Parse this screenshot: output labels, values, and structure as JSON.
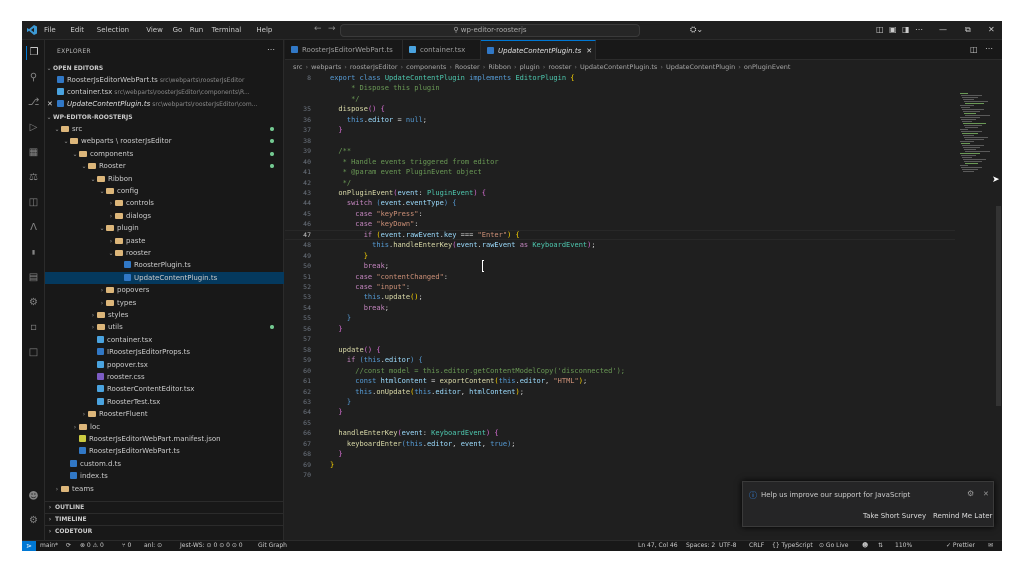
{
  "titlebar": {
    "menus": [
      "File",
      "Edit",
      "Selection",
      "View",
      "Go",
      "Run",
      "Terminal",
      "Help"
    ],
    "search": "wp-editor-roosterjs",
    "account": "⛭⌄"
  },
  "sidebar": {
    "title": "EXPLORER",
    "open_editors_label": "OPEN EDITORS",
    "open_editors": [
      {
        "name": "RoosterJsEditorWebPart.ts",
        "path": "src\\webparts\\roosterJsEditor",
        "icon": "ts"
      },
      {
        "name": "container.tsx",
        "path": "src\\webparts\\roosterJsEditor\\components\\R...",
        "icon": "tsx"
      },
      {
        "name": "UpdateContentPlugin.ts",
        "path": "src\\webparts\\roosterJsEditor\\com...",
        "icon": "ts",
        "active": true,
        "close": "✕"
      }
    ],
    "project_label": "WP-EDITOR-ROOSTERJS",
    "tree": [
      {
        "label": "src",
        "depth": 0,
        "kind": "folder-open",
        "dot": true
      },
      {
        "label": "webparts \\ roosterJsEditor",
        "depth": 1,
        "kind": "folder-open",
        "dot": true
      },
      {
        "label": "components",
        "depth": 2,
        "kind": "folder-open",
        "dot": true
      },
      {
        "label": "Rooster",
        "depth": 3,
        "kind": "folder-open",
        "dot": true
      },
      {
        "label": "Ribbon",
        "depth": 4,
        "kind": "folder-open"
      },
      {
        "label": "config",
        "depth": 5,
        "kind": "folder-open"
      },
      {
        "label": "controls",
        "depth": 6,
        "kind": "folder"
      },
      {
        "label": "dialogs",
        "depth": 6,
        "kind": "folder"
      },
      {
        "label": "plugin",
        "depth": 5,
        "kind": "folder-open"
      },
      {
        "label": "paste",
        "depth": 6,
        "kind": "folder"
      },
      {
        "label": "rooster",
        "depth": 6,
        "kind": "folder-open"
      },
      {
        "label": "RoosterPlugin.ts",
        "depth": 7,
        "kind": "ts"
      },
      {
        "label": "UpdateContentPlugin.ts",
        "depth": 7,
        "kind": "ts",
        "selected": true
      },
      {
        "label": "popovers",
        "depth": 5,
        "kind": "folder"
      },
      {
        "label": "types",
        "depth": 5,
        "kind": "folder"
      },
      {
        "label": "styles",
        "depth": 4,
        "kind": "folder"
      },
      {
        "label": "utils",
        "depth": 4,
        "kind": "folder",
        "dot": true
      },
      {
        "label": "container.tsx",
        "depth": 4,
        "kind": "tsx"
      },
      {
        "label": "IRoosterJsEditorProps.ts",
        "depth": 4,
        "kind": "ts"
      },
      {
        "label": "popover.tsx",
        "depth": 4,
        "kind": "tsx"
      },
      {
        "label": "rooster.css",
        "depth": 4,
        "kind": "css"
      },
      {
        "label": "RoosterContentEditor.tsx",
        "depth": 4,
        "kind": "tsx"
      },
      {
        "label": "RoosterTest.tsx",
        "depth": 4,
        "kind": "tsx"
      },
      {
        "label": "RoosterFluent",
        "depth": 3,
        "kind": "folder"
      },
      {
        "label": "loc",
        "depth": 2,
        "kind": "folder"
      },
      {
        "label": "RoosterJsEditorWebPart.manifest.json",
        "depth": 2,
        "kind": "json"
      },
      {
        "label": "RoosterJsEditorWebPart.ts",
        "depth": 2,
        "kind": "ts"
      },
      {
        "label": "custom.d.ts",
        "depth": 1,
        "kind": "ts"
      },
      {
        "label": "index.ts",
        "depth": 1,
        "kind": "ts"
      },
      {
        "label": "teams",
        "depth": 0,
        "kind": "folder"
      }
    ],
    "sections": [
      "OUTLINE",
      "TIMELINE",
      "CODETOUR"
    ]
  },
  "tabs": [
    {
      "label": "RoosterJsEditorWebPart.ts",
      "icon": "ts"
    },
    {
      "label": "container.tsx",
      "icon": "tsx"
    },
    {
      "label": "UpdateContentPlugin.ts",
      "icon": "ts",
      "active": true,
      "close": "✕"
    }
  ],
  "breadcrumbs": [
    "src",
    "webparts",
    "roosterJsEditor",
    "components",
    "Rooster",
    "Ribbon",
    "plugin",
    "rooster",
    "UpdateContentPlugin.ts",
    "UpdateContentPlugin",
    "onPluginEvent"
  ],
  "code": [
    {
      "n": "8",
      "t": [
        [
          "kw2",
          "export "
        ],
        [
          "kw2",
          "class "
        ],
        [
          "ty",
          "UpdateContentPlugin "
        ],
        [
          "kw2",
          "implements "
        ],
        [
          "ty",
          "EditorPlugin "
        ],
        [
          "br",
          "{"
        ]
      ]
    },
    {
      "n": "",
      "t": [
        [
          "cm",
          "     * Dispose this plugin"
        ]
      ]
    },
    {
      "n": "",
      "t": [
        [
          "cm",
          "     */"
        ]
      ]
    },
    {
      "n": "35",
      "t": [
        [
          "fn",
          "  dispose"
        ],
        [
          "br2",
          "()"
        ],
        [
          "pl",
          " "
        ],
        [
          "br2",
          "{"
        ]
      ]
    },
    {
      "n": "36",
      "t": [
        [
          "kw2",
          "    this"
        ],
        [
          "pl",
          "."
        ],
        [
          "va",
          "editor"
        ],
        [
          "pl",
          " = "
        ],
        [
          "kw2",
          "null"
        ],
        [
          "pl",
          ";"
        ]
      ]
    },
    {
      "n": "37",
      "t": [
        [
          "br2",
          "  }"
        ]
      ]
    },
    {
      "n": "38",
      "t": [
        [
          "pl",
          ""
        ]
      ]
    },
    {
      "n": "39",
      "t": [
        [
          "cm",
          "  /**"
        ]
      ]
    },
    {
      "n": "40",
      "t": [
        [
          "cm",
          "   * Handle events triggered from editor"
        ]
      ]
    },
    {
      "n": "41",
      "t": [
        [
          "cm",
          "   * @param event PluginEvent object"
        ]
      ]
    },
    {
      "n": "42",
      "t": [
        [
          "cm",
          "   */"
        ]
      ]
    },
    {
      "n": "43",
      "t": [
        [
          "fn",
          "  onPluginEvent"
        ],
        [
          "br2",
          "("
        ],
        [
          "va",
          "event"
        ],
        [
          "pl",
          ": "
        ],
        [
          "ty",
          "PluginEvent"
        ],
        [
          "br2",
          ")"
        ],
        [
          "pl",
          " "
        ],
        [
          "br2",
          "{"
        ]
      ]
    },
    {
      "n": "44",
      "t": [
        [
          "kw",
          "    switch "
        ],
        [
          "kw2",
          "("
        ],
        [
          "va",
          "event"
        ],
        [
          "pl",
          "."
        ],
        [
          "va",
          "eventType"
        ],
        [
          "kw2",
          ")"
        ],
        [
          "pl",
          " "
        ],
        [
          "kw2",
          "{"
        ]
      ]
    },
    {
      "n": "45",
      "t": [
        [
          "kw",
          "      case "
        ],
        [
          "st",
          "\"keyPress\""
        ],
        [
          "pl",
          ":"
        ]
      ]
    },
    {
      "n": "46",
      "t": [
        [
          "kw",
          "      case "
        ],
        [
          "st",
          "\"keyDown\""
        ],
        [
          "pl",
          ":"
        ]
      ]
    },
    {
      "n": "47",
      "t": [
        [
          "kw",
          "        if "
        ],
        [
          "br",
          "("
        ],
        [
          "va",
          "event"
        ],
        [
          "pl",
          "."
        ],
        [
          "va",
          "rawEvent"
        ],
        [
          "pl",
          "."
        ],
        [
          "va",
          "key"
        ],
        [
          "pl",
          " === "
        ],
        [
          "st",
          "\"Enter\""
        ],
        [
          "br",
          ")"
        ],
        [
          "pl",
          " "
        ],
        [
          "br",
          "{"
        ]
      ],
      "current": true
    },
    {
      "n": "48",
      "t": [
        [
          "kw2",
          "          this"
        ],
        [
          "pl",
          "."
        ],
        [
          "fn",
          "handleEnterKey"
        ],
        [
          "br2",
          "("
        ],
        [
          "va",
          "event"
        ],
        [
          "pl",
          "."
        ],
        [
          "va",
          "rawEvent"
        ],
        [
          "kw",
          " as "
        ],
        [
          "ty",
          "KeyboardEvent"
        ],
        [
          "br2",
          ")"
        ],
        [
          "pl",
          ";"
        ]
      ]
    },
    {
      "n": "49",
      "t": [
        [
          "br",
          "        }"
        ]
      ]
    },
    {
      "n": "50",
      "t": [
        [
          "kw",
          "        break"
        ],
        [
          "pl",
          ";"
        ]
      ]
    },
    {
      "n": "51",
      "t": [
        [
          "kw",
          "      case "
        ],
        [
          "st",
          "\"contentChanged\""
        ],
        [
          "pl",
          ":"
        ]
      ]
    },
    {
      "n": "52",
      "t": [
        [
          "kw",
          "      case "
        ],
        [
          "st",
          "\"input\""
        ],
        [
          "pl",
          ":"
        ]
      ]
    },
    {
      "n": "53",
      "t": [
        [
          "kw2",
          "        this"
        ],
        [
          "pl",
          "."
        ],
        [
          "fn",
          "update"
        ],
        [
          "br",
          "()"
        ],
        [
          "pl",
          ";"
        ]
      ]
    },
    {
      "n": "54",
      "t": [
        [
          "kw",
          "        break"
        ],
        [
          "pl",
          ";"
        ]
      ]
    },
    {
      "n": "55",
      "t": [
        [
          "kw2",
          "    }"
        ]
      ]
    },
    {
      "n": "56",
      "t": [
        [
          "br2",
          "  }"
        ]
      ]
    },
    {
      "n": "57",
      "t": [
        [
          "pl",
          ""
        ]
      ]
    },
    {
      "n": "58",
      "t": [
        [
          "fn",
          "  update"
        ],
        [
          "br2",
          "()"
        ],
        [
          "pl",
          " "
        ],
        [
          "br2",
          "{"
        ]
      ]
    },
    {
      "n": "59",
      "t": [
        [
          "kw",
          "    if "
        ],
        [
          "kw2",
          "("
        ],
        [
          "kw2",
          "this"
        ],
        [
          "pl",
          "."
        ],
        [
          "va",
          "editor"
        ],
        [
          "kw2",
          ")"
        ],
        [
          "pl",
          " "
        ],
        [
          "kw2",
          "{"
        ]
      ]
    },
    {
      "n": "60",
      "t": [
        [
          "cm",
          "      //const model = this.editor.getContentModelCopy('disconnected');"
        ]
      ]
    },
    {
      "n": "61",
      "t": [
        [
          "kw2",
          "      const "
        ],
        [
          "va",
          "htmlContent"
        ],
        [
          "pl",
          " = "
        ],
        [
          "fn",
          "exportContent"
        ],
        [
          "br",
          "("
        ],
        [
          "kw2",
          "this"
        ],
        [
          "pl",
          "."
        ],
        [
          "va",
          "editor"
        ],
        [
          "pl",
          ", "
        ],
        [
          "st",
          "\"HTML\""
        ],
        [
          "br",
          ")"
        ],
        [
          "pl",
          ";"
        ]
      ]
    },
    {
      "n": "62",
      "t": [
        [
          "kw2",
          "      this"
        ],
        [
          "pl",
          "."
        ],
        [
          "fn",
          "onUpdate"
        ],
        [
          "br",
          "("
        ],
        [
          "kw2",
          "this"
        ],
        [
          "pl",
          "."
        ],
        [
          "va",
          "editor"
        ],
        [
          "pl",
          ", "
        ],
        [
          "va",
          "htmlContent"
        ],
        [
          "br",
          ")"
        ],
        [
          "pl",
          ";"
        ]
      ]
    },
    {
      "n": "63",
      "t": [
        [
          "kw2",
          "    }"
        ]
      ]
    },
    {
      "n": "64",
      "t": [
        [
          "br2",
          "  }"
        ]
      ]
    },
    {
      "n": "65",
      "t": [
        [
          "pl",
          ""
        ]
      ]
    },
    {
      "n": "66",
      "t": [
        [
          "fn",
          "  handleEnterKey"
        ],
        [
          "br2",
          "("
        ],
        [
          "va",
          "event"
        ],
        [
          "pl",
          ": "
        ],
        [
          "ty",
          "KeyboardEvent"
        ],
        [
          "br2",
          ")"
        ],
        [
          "pl",
          " "
        ],
        [
          "br2",
          "{"
        ]
      ]
    },
    {
      "n": "67",
      "t": [
        [
          "fn",
          "    keyboardEnter"
        ],
        [
          "kw2",
          "("
        ],
        [
          "kw2",
          "this"
        ],
        [
          "pl",
          "."
        ],
        [
          "va",
          "editor"
        ],
        [
          "pl",
          ", "
        ],
        [
          "va",
          "event"
        ],
        [
          "pl",
          ", "
        ],
        [
          "kw2",
          "true"
        ],
        [
          "kw2",
          ")"
        ],
        [
          "pl",
          ";"
        ]
      ]
    },
    {
      "n": "68",
      "t": [
        [
          "br2",
          "  }"
        ]
      ]
    },
    {
      "n": "69",
      "t": [
        [
          "br",
          "}"
        ]
      ]
    },
    {
      "n": "70",
      "t": [
        [
          "pl",
          ""
        ]
      ]
    }
  ],
  "status": {
    "branch": "main*",
    "sync": "⟳",
    "problems": "⊗ 0 ⚠ 0",
    "ports": "⑂ 0",
    "ws1": "anl: ⊙",
    "ws2": "Jest-WS: ⊙ 0 ⊙ 0 ⊙ 0",
    "git_graph": "Git Graph",
    "cursor": "Ln 47, Col 46",
    "spaces": "Spaces: 2",
    "encoding": "UTF-8",
    "eol": "CRLF",
    "language": "{} TypeScript",
    "golive": "⊙ Go Live",
    "zoom": "110%",
    "prettier": "✓ Prettier"
  },
  "toast": {
    "message": "Help us improve our support for JavaScript",
    "primary": "Take Short Survey",
    "secondary": "Remind Me Later"
  },
  "colors": {
    "accent": "#0078d4",
    "folder": "#dcb67a",
    "ts": "#3178c6",
    "modified": "#73c991"
  }
}
